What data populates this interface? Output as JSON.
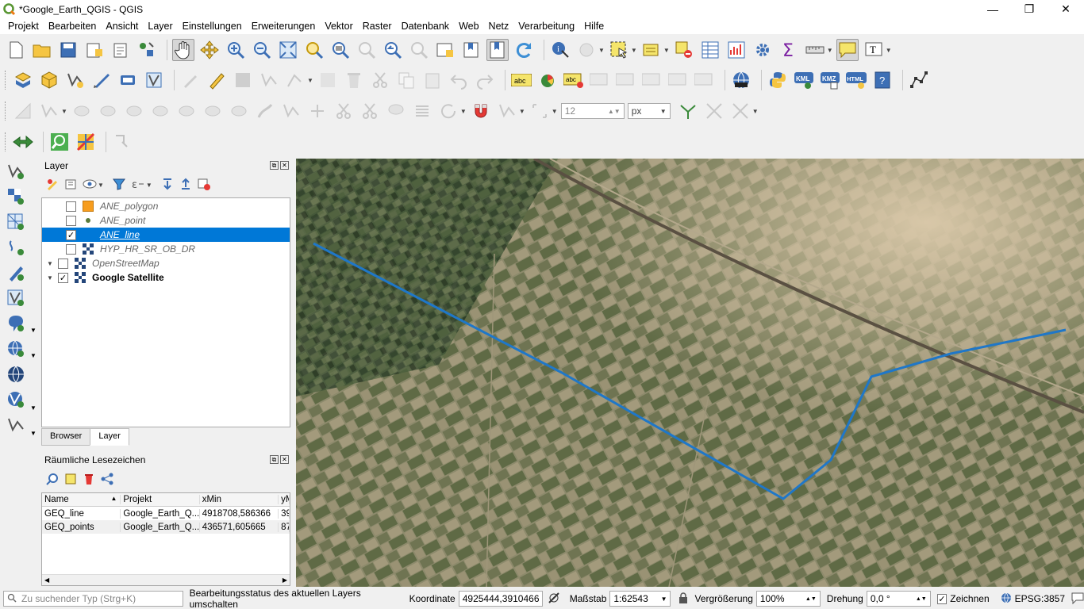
{
  "window": {
    "title": "*Google_Earth_QGIS - QGIS",
    "controls": [
      "—",
      "❐",
      "✕"
    ]
  },
  "menu": [
    "Projekt",
    "Bearbeiten",
    "Ansicht",
    "Layer",
    "Einstellungen",
    "Erweiterungen",
    "Vektor",
    "Raster",
    "Datenbank",
    "Web",
    "Netz",
    "Verarbeitung",
    "Hilfe"
  ],
  "snapping": {
    "tolerance": "12",
    "unit": "px"
  },
  "toolbar_labels": {
    "kml": "KML",
    "kmz": "KMZ",
    "html": "HTML",
    "abc": "abc"
  },
  "layers_panel": {
    "title": "Layer",
    "layers": [
      {
        "name": "ANE_polygon",
        "checked": false,
        "icon": "polygon-icon",
        "color": "#f79d1e"
      },
      {
        "name": "ANE_point",
        "checked": false,
        "icon": "point-icon",
        "color": "#5a7a3a"
      },
      {
        "name": "ANE_line",
        "checked": true,
        "icon": "line-icon",
        "selected": true
      },
      {
        "name": "HYP_HR_SR_OB_DR",
        "checked": false,
        "icon": "raster-icon"
      },
      {
        "name": "OpenStreetMap",
        "checked": false,
        "icon": "raster-icon",
        "expandable": true
      },
      {
        "name": "Google Satellite",
        "checked": true,
        "icon": "raster-icon",
        "expandable": true,
        "bold": true
      }
    ],
    "tabs": [
      "Browser",
      "Layer"
    ]
  },
  "bookmarks_panel": {
    "title": "Räumliche Lesezeichen",
    "columns": [
      "Name",
      "Projekt",
      "xMin",
      "yM"
    ],
    "rows": [
      [
        "GEQ_line",
        "Google_Earth_Q...",
        "4918708,586366",
        "39"
      ],
      [
        "GEQ_points",
        "Google_Earth_Q...",
        "436571,605665",
        "87"
      ]
    ]
  },
  "status": {
    "search_placeholder": "Zu suchender Typ (Strg+K)",
    "message": "Bearbeitungsstatus des aktuellen Layers umschalten",
    "coord_label": "Koordinate",
    "coord_value": "4925444,3910466",
    "scale_label": "Maßstab",
    "scale_value": "1:62543",
    "mag_label": "Vergrößerung",
    "mag_value": "100%",
    "rot_label": "Drehung",
    "rot_value": "0,0 °",
    "render_label": "Zeichnen",
    "crs": "EPSG:3857"
  },
  "colors": {
    "selection": "#0078d7",
    "line_feature": "#1f77c8",
    "accent_orange": "#f79d1e"
  }
}
